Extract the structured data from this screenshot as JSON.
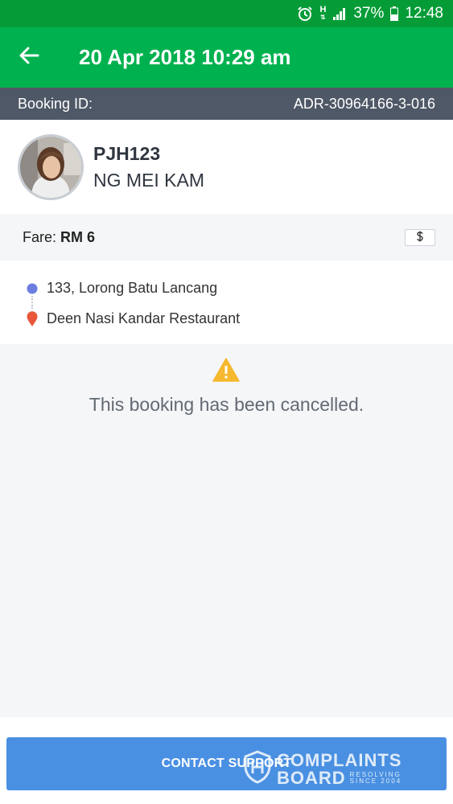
{
  "status_bar": {
    "battery": "37%",
    "time": "12:48",
    "network": "H"
  },
  "header": {
    "title": "20 Apr 2018 10:29 am",
    "back_icon": "arrow-left-icon"
  },
  "booking": {
    "label": "Booking ID:",
    "id": "ADR-30964166-3-016"
  },
  "driver": {
    "plate": "PJH123",
    "name": "NG MEI KAM"
  },
  "fare": {
    "label": "Fare: ",
    "amount": "RM 6",
    "payment_icon": "dollar-icon"
  },
  "route": {
    "pickup": "133, Lorong Batu Lancang",
    "dropoff": "Deen Nasi Kandar Restaurant"
  },
  "status": {
    "message": "This booking has been cancelled.",
    "icon": "warning-icon"
  },
  "footer": {
    "contact_label": "CONTACT SUPPORT"
  },
  "watermark": {
    "line1": "COMPLAINTS",
    "line2": "BOARD",
    "tag1": "RESOLVING",
    "tag2": "SINCE 2004"
  },
  "colors": {
    "status_bar": "#059c37",
    "app_bar": "#00b14f",
    "booking_bar": "#4f5866",
    "button": "#4a90e2",
    "pickup_dot": "#6c7fe0",
    "dropoff_pin": "#e8573a",
    "warning": "#f5b82e"
  }
}
